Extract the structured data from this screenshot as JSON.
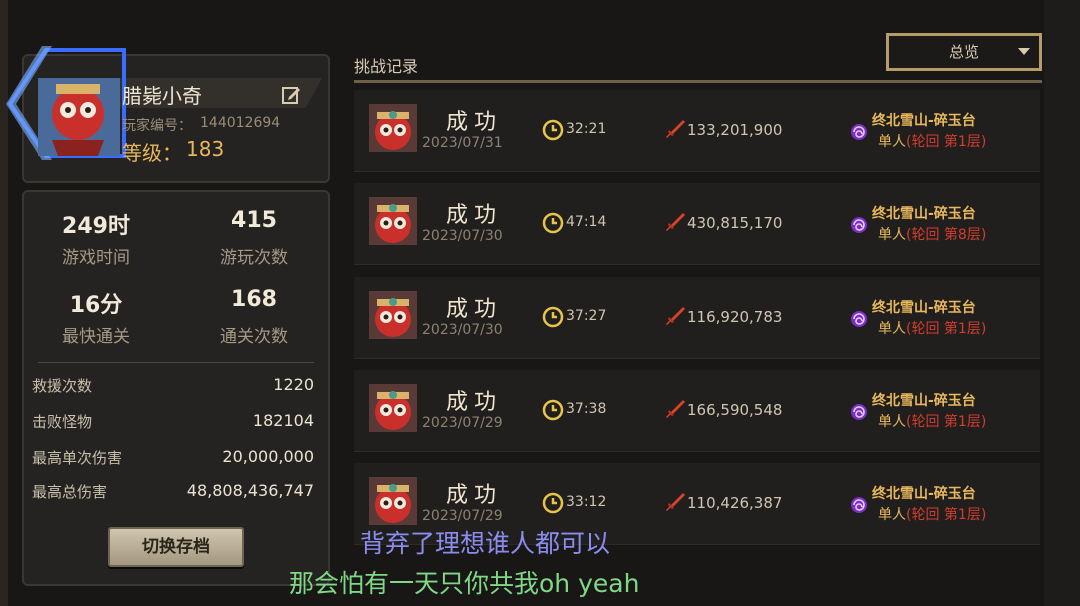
{
  "player": {
    "name": "腊毙小奇",
    "id_label": "玩家编号：",
    "id": "144012694",
    "level_label": "等级：",
    "level": "183"
  },
  "stats": {
    "play_time": {
      "value": "249时",
      "label": "游戏时间"
    },
    "play_count": {
      "value": "415",
      "label": "游玩次数"
    },
    "fastest_clear": {
      "value": "16分",
      "label": "最快通关"
    },
    "clear_count": {
      "value": "168",
      "label": "通关次数"
    },
    "rows": [
      {
        "label": "救援次数",
        "value": "1220"
      },
      {
        "label": "击败怪物",
        "value": "182104"
      },
      {
        "label": "最高单次伤害",
        "value": "20,000,000"
      },
      {
        "label": "最高总伤害",
        "value": "48,808,436,747"
      }
    ]
  },
  "switch_save_label": "切换存档",
  "records_title": "挑战记录",
  "overview_select": "总览",
  "records": [
    {
      "result": "成功",
      "date": "2023/07/31",
      "time": "32:21",
      "damage": "133,201,900",
      "map": "终北雪山-碎玉台",
      "mode": "单人",
      "mode_detail": "(轮回 第1层)"
    },
    {
      "result": "成功",
      "date": "2023/07/30",
      "time": "47:14",
      "damage": "430,815,170",
      "map": "终北雪山-碎玉台",
      "mode": "单人",
      "mode_detail": "(轮回 第8层)"
    },
    {
      "result": "成功",
      "date": "2023/07/30",
      "time": "37:27",
      "damage": "116,920,783",
      "map": "终北雪山-碎玉台",
      "mode": "单人",
      "mode_detail": "(轮回 第1层)"
    },
    {
      "result": "成功",
      "date": "2023/07/29",
      "time": "37:38",
      "damage": "166,590,548",
      "map": "终北雪山-碎玉台",
      "mode": "单人",
      "mode_detail": "(轮回 第1层)"
    },
    {
      "result": "成功",
      "date": "2023/07/29",
      "time": "33:12",
      "damage": "110,426,387",
      "map": "终北雪山-碎玉台",
      "mode": "单人",
      "mode_detail": "(轮回 第1层)"
    }
  ],
  "subtitles": {
    "line1": "背弃了理想谁人都可以",
    "line2": "那会怕有一天只你共我oh yeah"
  },
  "colors": {
    "accent_gold": "#e8b85c",
    "mode_red": "#d23c2e",
    "frame_blue": "#3a6cff"
  }
}
